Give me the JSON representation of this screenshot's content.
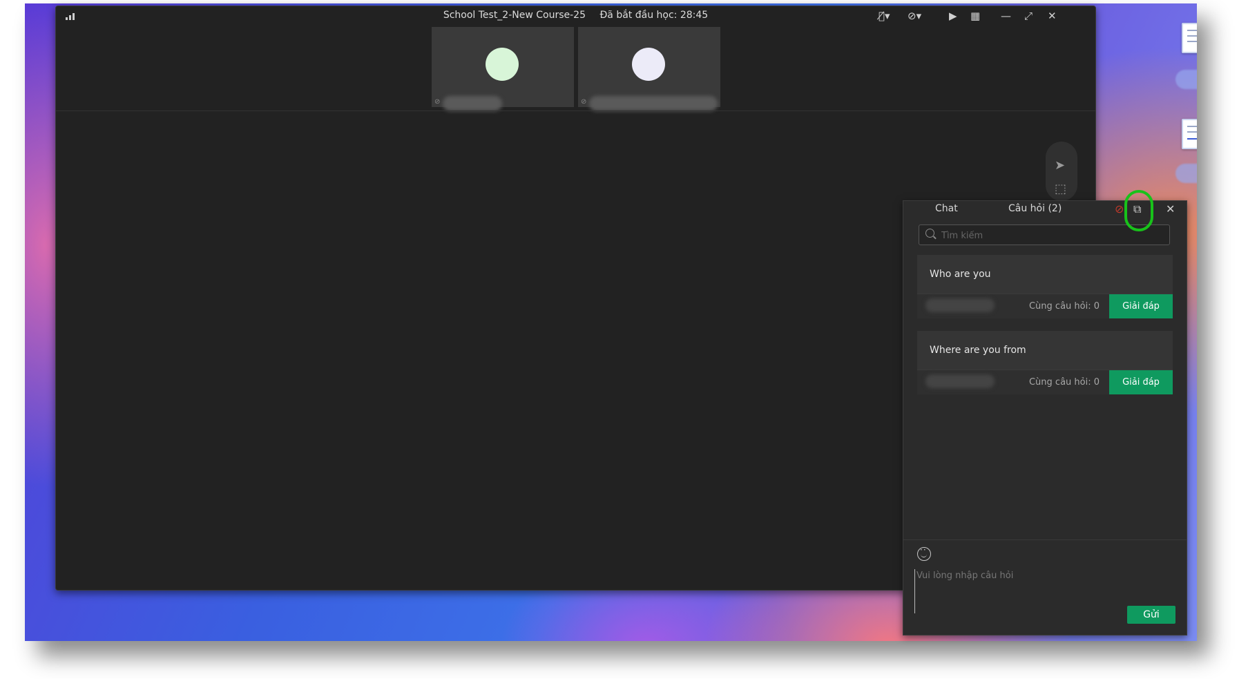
{
  "window": {
    "course_title": "School Test_2-New Course-25",
    "elapsed": "Đã bắt đầu học: 28:45",
    "icons": [
      "signal-icon",
      "mic-muted-icon",
      "speaker-muted-icon",
      "camera-icon",
      "grid-layout-icon",
      "minimize-icon",
      "fullscreen-icon",
      "close-icon"
    ]
  },
  "participants": [
    {
      "avatar_color": "#d8f5d8"
    },
    {
      "avatar_color": "#ecebf8"
    }
  ],
  "panel": {
    "tab_chat": "Chat",
    "tab_questions": "Câu hỏi (2)",
    "search_placeholder": "Tìm kiếm",
    "questions": [
      {
        "text": "Who are you",
        "same_label": "Cùng câu hỏi: 0",
        "answer_label": "Giải đáp"
      },
      {
        "text": "Where are you from",
        "same_label": "Cùng câu hỏi: 0",
        "answer_label": "Giải đáp"
      }
    ],
    "input_placeholder": "Vui lòng nhập câu hỏi",
    "send_label": "Gửi",
    "highlight_color": "#18c21a",
    "accent_color": "#0f9a5f"
  }
}
